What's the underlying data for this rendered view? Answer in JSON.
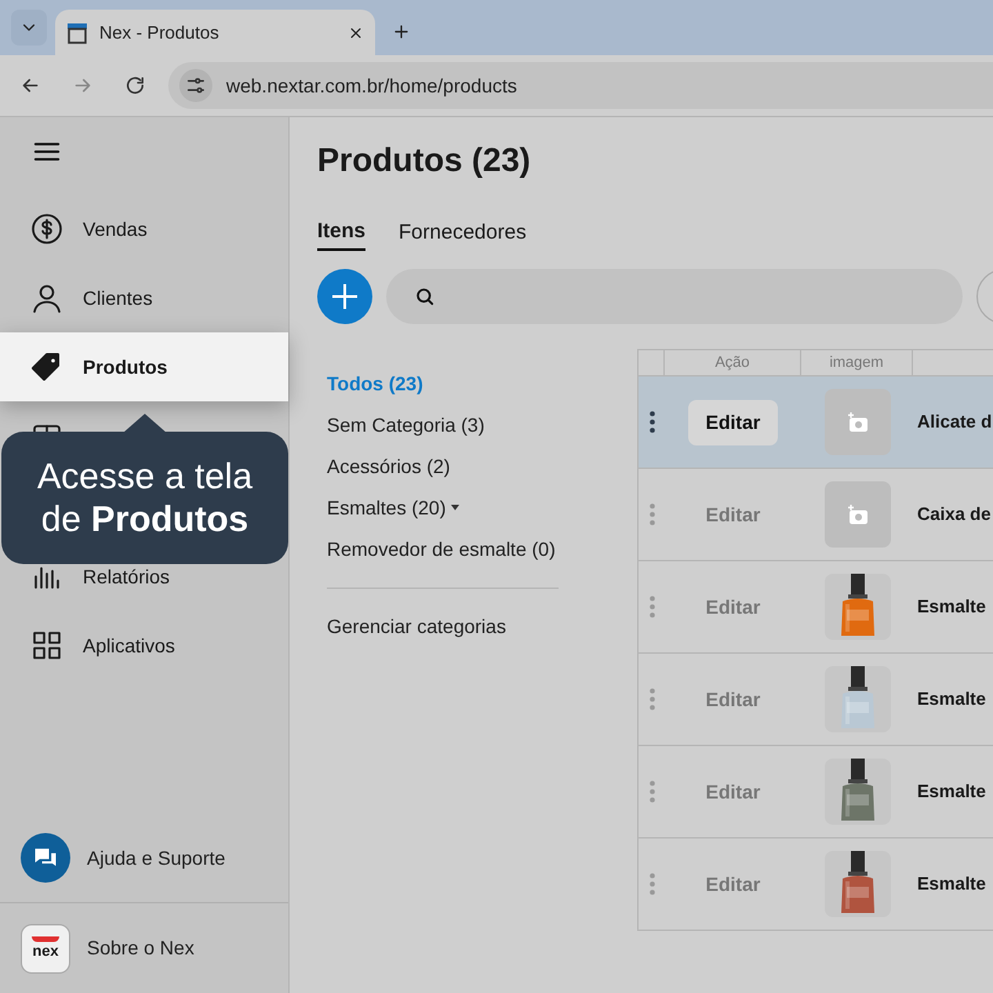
{
  "browser": {
    "tab_title": "Nex - Produtos",
    "url": "web.nextar.com.br/home/products"
  },
  "sidebar": {
    "items": [
      {
        "label": "Vendas",
        "selected": false
      },
      {
        "label": "Clientes",
        "selected": false
      },
      {
        "label": "Produtos",
        "selected": true
      },
      {
        "selected": false
      },
      {
        "label": "Relatórios",
        "selected": false
      },
      {
        "label": "Aplicativos",
        "selected": false
      }
    ],
    "help": "Ajuda e Suporte",
    "about": "Sobre o Nex",
    "logo_text": "nex"
  },
  "tooltip": "Acesse a tela de **Produtos**",
  "page": {
    "title": "Produtos (23)",
    "tabs": [
      {
        "label": "Itens",
        "selected": true
      },
      {
        "label": "Fornecedores",
        "selected": false
      }
    ]
  },
  "categories": [
    {
      "label": "Todos (23)",
      "selected": true,
      "expandable": false
    },
    {
      "label": "Sem Categoria (3)",
      "selected": false,
      "expandable": false
    },
    {
      "label": "Acessórios (2)",
      "selected": false,
      "expandable": false
    },
    {
      "label": "Esmaltes (20)",
      "selected": false,
      "expandable": true
    },
    {
      "label": "Removedor de esmalte (0)",
      "selected": false,
      "expandable": false
    }
  ],
  "manage_categories": "Gerenciar categorias",
  "table": {
    "columns": [
      "Ação",
      "imagem"
    ],
    "rows": [
      {
        "action": "Editar",
        "image": {
          "kind": "placeholder"
        },
        "name": "Alicate d",
        "selected": true
      },
      {
        "action": "Editar",
        "image": {
          "kind": "placeholder"
        },
        "name": "Caixa de",
        "selected": false
      },
      {
        "action": "Editar",
        "name": "Esmalte",
        "selected": false
      },
      {
        "action": "Editar",
        "name": "Esmalte",
        "selected": false
      },
      {
        "action": "Editar",
        "name": "Esmalte",
        "selected": false
      },
      {
        "action": "Editar",
        "name": "Esmalte",
        "selected": false
      }
    ]
  }
}
